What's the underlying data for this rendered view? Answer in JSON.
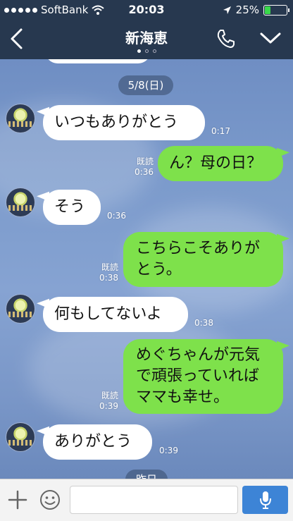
{
  "status_bar": {
    "carrier": "SoftBank",
    "time": "20:03",
    "battery": "25%",
    "battery_level": 0.25,
    "icons": [
      "signal-dots-icon",
      "wifi-icon",
      "location-arrow-icon",
      "battery-icon"
    ]
  },
  "header": {
    "title": "新海恵",
    "page_count": 3,
    "active_page": 1,
    "icons": [
      "back-chevron-icon",
      "phone-icon",
      "chevron-down-icon"
    ]
  },
  "chat": {
    "date_label": "5/8(日)",
    "next_date_label": "昨日",
    "messages": [
      {
        "side": "in",
        "text": "いつもありがとう",
        "time": "0:17"
      },
      {
        "side": "out",
        "text": "ん？母の日？",
        "read": "既読",
        "time": "0:36"
      },
      {
        "side": "in",
        "text": "そう",
        "time": "0:36"
      },
      {
        "side": "out",
        "lines": [
          "こちらこそありが",
          "とう。"
        ],
        "read": "既読",
        "time": "0:38"
      },
      {
        "side": "in",
        "text": "何もしてないよ",
        "time": "0:38"
      },
      {
        "side": "out",
        "lines": [
          "めぐちゃんが元気",
          "で頑張っていれば",
          "ママも幸せ。"
        ],
        "read": "既読",
        "time": "0:39"
      },
      {
        "side": "in",
        "text": "ありがとう",
        "time": "0:39"
      }
    ]
  },
  "input_bar": {
    "value": "",
    "icons": [
      "plus-icon",
      "smiley-icon",
      "microphone-icon"
    ]
  },
  "colors": {
    "nav_bg": "#27384f",
    "bubble_out": "#7ee14b",
    "bubble_in": "#ffffff",
    "mic_button": "#3d84d6",
    "battery_fill": "#39d94b"
  }
}
